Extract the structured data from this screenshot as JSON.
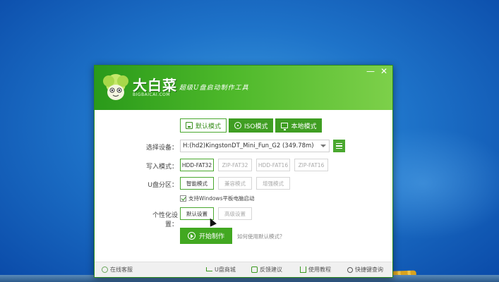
{
  "window": {
    "brand_title": "大白菜",
    "brand_domain": "BIGBAICAI.COM",
    "slogan": "超级U盘启动制作工具",
    "minimize_glyph": "—",
    "close_glyph": "✕"
  },
  "modes": [
    {
      "label": "默认模式",
      "icon": "usb-disk-icon",
      "active": true
    },
    {
      "label": "ISO模式",
      "icon": "cd-icon",
      "active": false
    },
    {
      "label": "本地模式",
      "icon": "computer-icon",
      "active": false
    }
  ],
  "form": {
    "device_label": "选择设备：",
    "device_value": "H:(hd2)KingstonDT_Mini_Fun_G2 (349.78m)",
    "write_mode_label": "写入模式：",
    "write_modes": [
      "HDD-FAT32",
      "ZIP-FAT32",
      "HDD-FAT16",
      "ZIP-FAT16"
    ],
    "partition_label": "U盘分区：",
    "partition_modes": [
      "智能模式",
      "兼容模式",
      "增强模式"
    ],
    "windows_boot_label": "支持Windows平板电脑启动",
    "personalize_label": "个性化设置：",
    "personalize_options": [
      "默认设置",
      "高级设置"
    ],
    "start_button": "开始制作",
    "help_link": "如何使用默认模式？"
  },
  "footer": {
    "online": "在线客服",
    "shop": "U盘商城",
    "feedback": "反馈建议",
    "tutorial": "使用教程",
    "shortcut": "快捷键查询"
  },
  "colors": {
    "brand_green": "#42a821",
    "desktop_blue": "#1e73c9"
  }
}
